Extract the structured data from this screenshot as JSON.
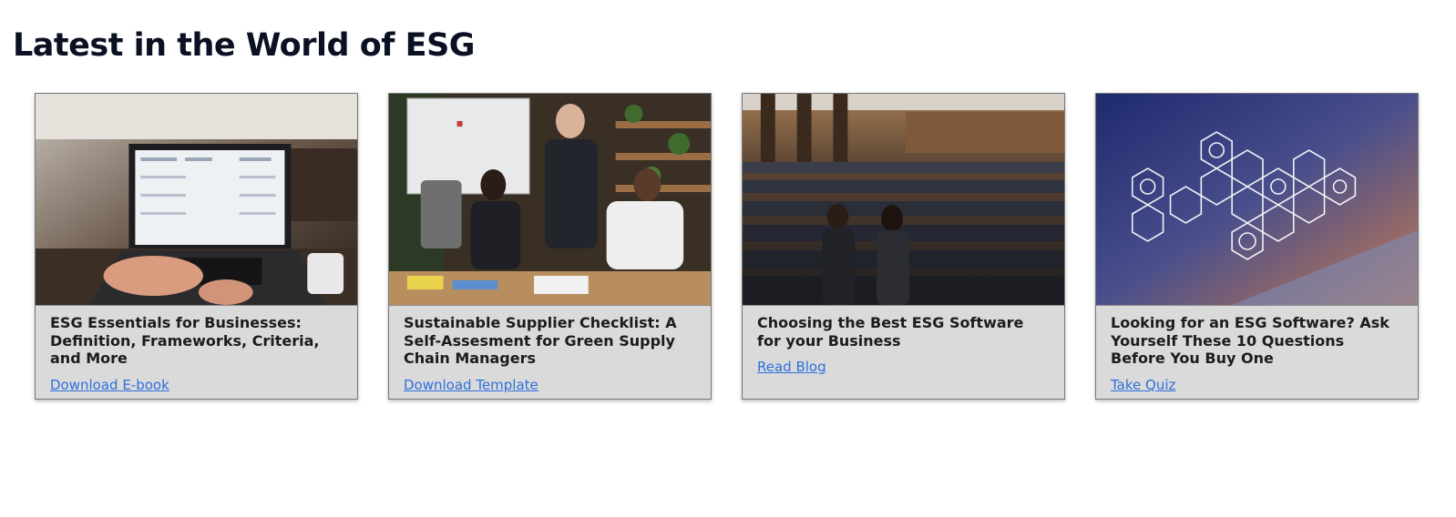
{
  "section": {
    "title": "Latest in the World of ESG"
  },
  "cards": [
    {
      "title": "ESG Essentials for Businesses: Definition, Frameworks, Criteria, and More",
      "link_label": "Download E-book",
      "image": "laptop-dashboard-photo"
    },
    {
      "title": "Sustainable Supplier Checklist: A Self-Assesment for Green Supply Chain Managers",
      "link_label": "Download Template",
      "image": "office-meeting-photo"
    },
    {
      "title": "Choosing the Best ESG Software for your Business",
      "link_label": "Read Blog",
      "image": "auditorium-presentation-photo"
    },
    {
      "title": "Looking for an ESG Software? Ask Yourself These 10 Questions Before You Buy One",
      "link_label": "Take Quiz",
      "image": "hexagon-tech-icons-photo"
    }
  ],
  "colors": {
    "heading": "#0b1023",
    "card_background": "#dadada",
    "link": "#2f6fdc"
  }
}
